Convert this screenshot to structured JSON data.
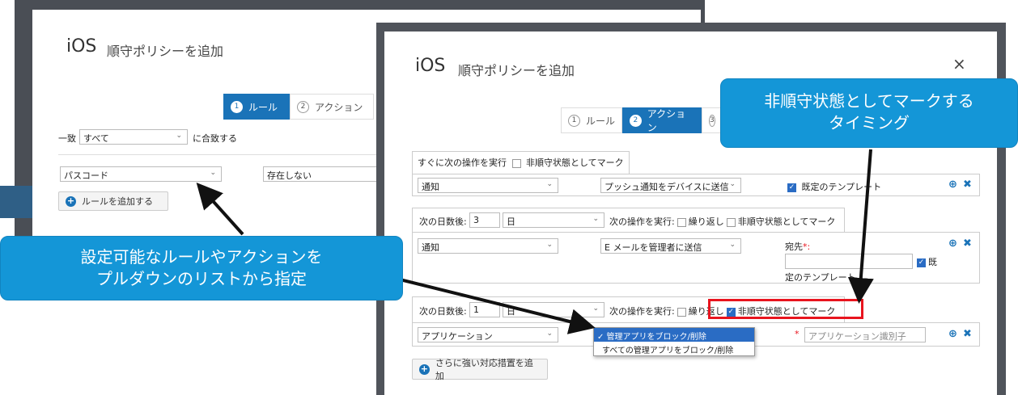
{
  "back_dialog": {
    "ios": "iOS",
    "title": "順守ポリシーを追加",
    "steps": [
      {
        "num": "1",
        "label": "ルール"
      },
      {
        "num": "2",
        "label": "アクション"
      }
    ],
    "match_prefix": "一致",
    "match_value": "すべて",
    "match_suffix": "に合致する",
    "rule_field": "パスコード",
    "rule_condition": "存在しない",
    "add_rule": "ルールを追加する"
  },
  "front_dialog": {
    "ios": "iOS",
    "title": "順守ポリシーを追加",
    "close": "×",
    "steps": [
      {
        "num": "1",
        "label": "ルール"
      },
      {
        "num": "2",
        "label": "アクション"
      },
      {
        "num": "3",
        "label": ""
      }
    ],
    "block1": {
      "header_a": "すぐに次の操作を実行",
      "header_b": "非順守状態としてマーク",
      "type": "通知",
      "action": "プッシュ通知をデバイスに送信",
      "template": "既定のテンプレート"
    },
    "block2": {
      "days_label": "次の日数後:",
      "days": "3",
      "unit": "日",
      "exec": "次の操作を実行:",
      "repeat": "繰り返し",
      "mark": "非順守状態としてマーク",
      "type": "通知",
      "action": "E メールを管理者に送信",
      "to_label": "宛先",
      "to_star": "*:",
      "template_a": "既",
      "template_b": "定のテンプレート"
    },
    "block3": {
      "days_label": "次の日数後:",
      "days": "1",
      "unit": "日",
      "exec": "次の操作を実行:",
      "repeat": "繰り返し",
      "mark": "非順守状態としてマーク",
      "type": "アプリケーション",
      "dropdown": [
        "✓ 管理アプリをブロック/削除",
        "すべての管理アプリをブロック/削除"
      ],
      "app_id_placeholder": "アプリケーション識別子"
    },
    "add_stronger": "さらに強い対応措置を追加"
  },
  "callouts": {
    "left": [
      "設定可能なルールやアクションを",
      "プルダウンのリストから指定"
    ],
    "right": [
      "非順守状態としてマークする",
      "タイミング"
    ]
  },
  "colors": {
    "accent": "#1a73b8",
    "callout": "#1496d7",
    "highlight": "#e8141e"
  }
}
